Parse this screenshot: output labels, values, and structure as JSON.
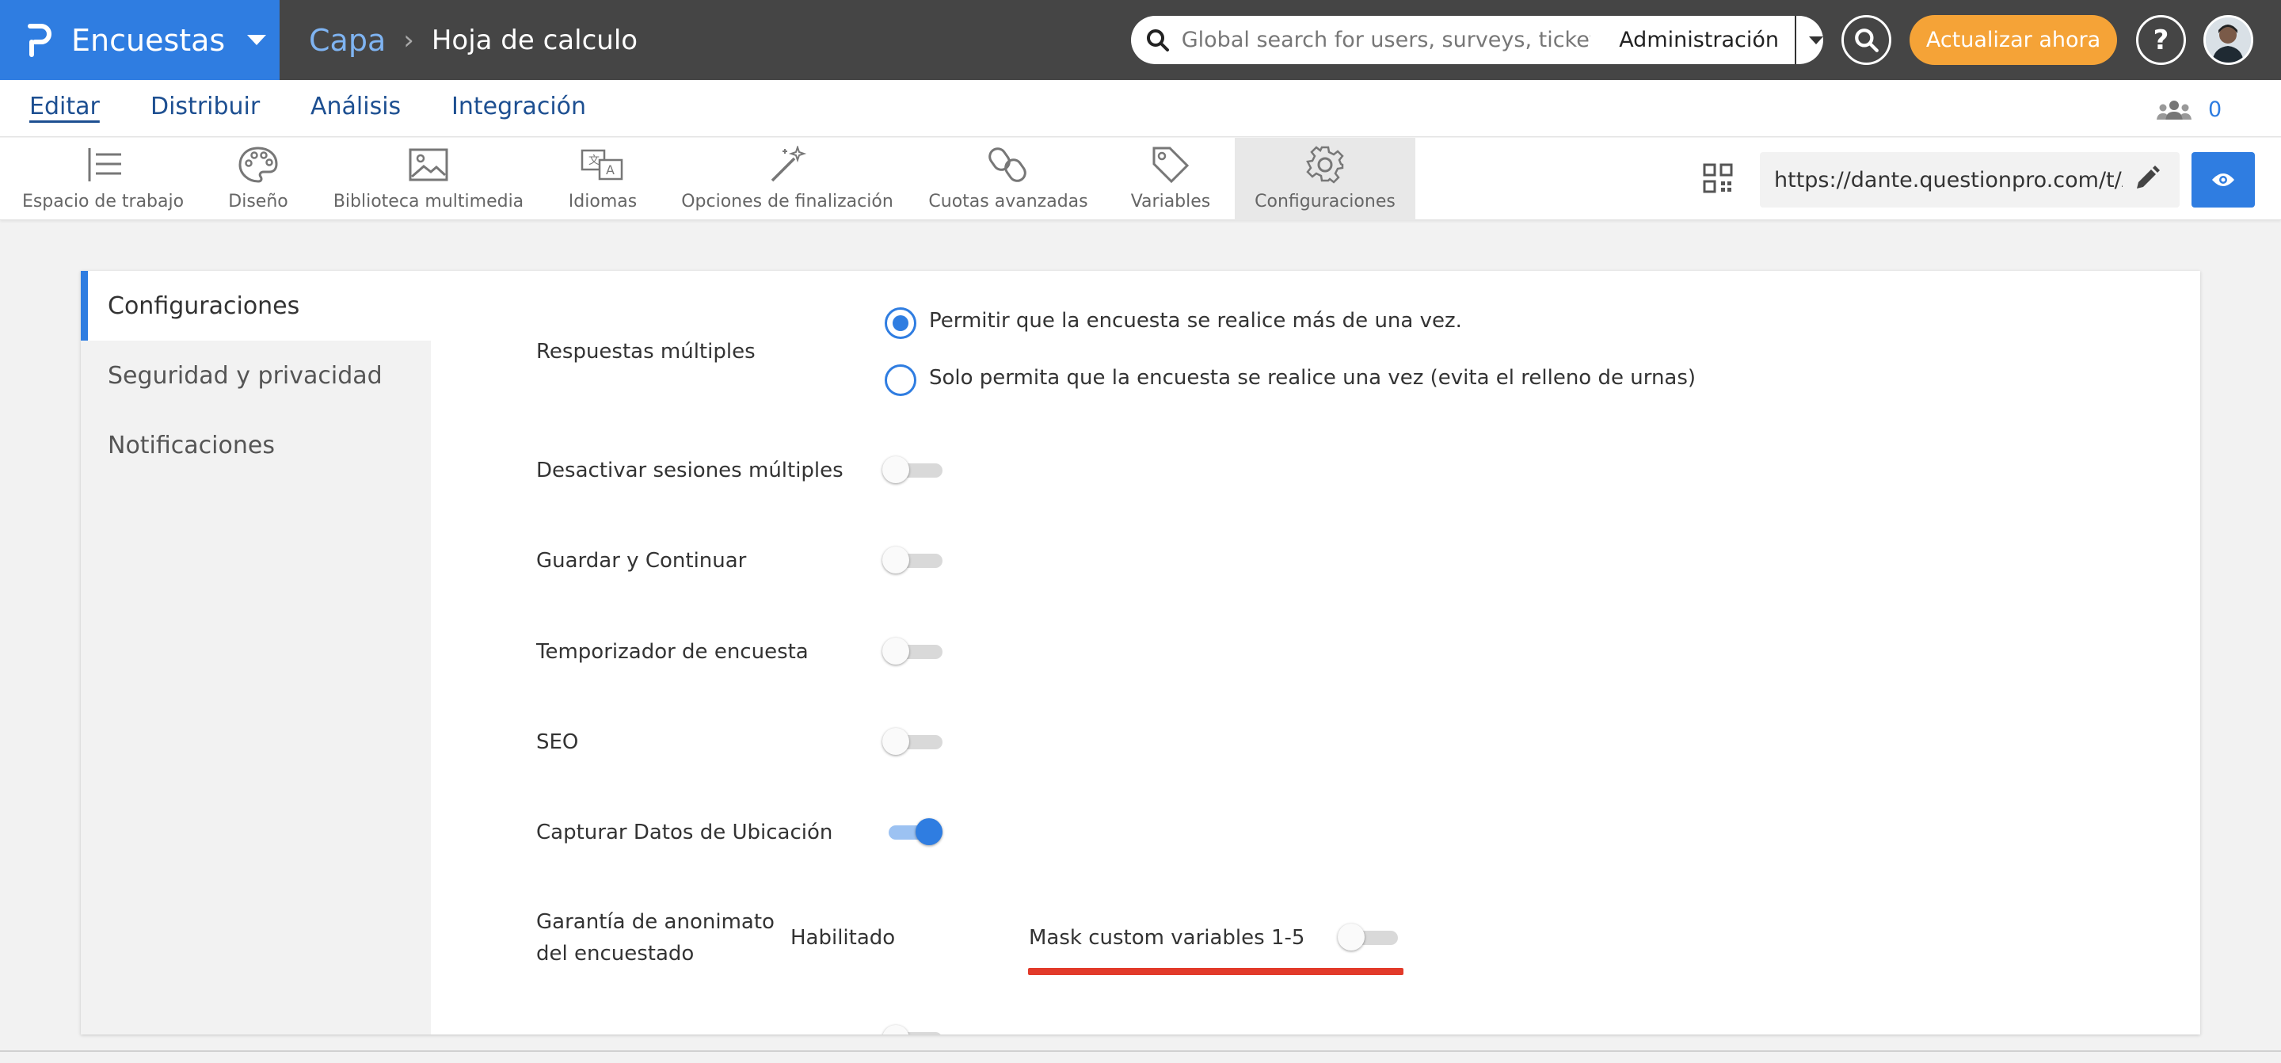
{
  "topbar": {
    "brand": "Encuestas",
    "breadcrumb": [
      "Capa",
      "Hoja de calculo"
    ],
    "search_placeholder": "Global search for users, surveys, tickets",
    "search_scope": "Administración",
    "upgrade_label": "Actualizar ahora",
    "help_label": "?"
  },
  "nav": {
    "tabs": [
      "Editar",
      "Distribuir",
      "Análisis",
      "Integración"
    ],
    "active_tab": "Editar",
    "collaborators_count": "0"
  },
  "toolbar": {
    "tools": [
      {
        "label": "Espacio de trabajo",
        "icon": "workspace-icon"
      },
      {
        "label": "Diseño",
        "icon": "palette-icon"
      },
      {
        "label": "Biblioteca multimedia",
        "icon": "image-icon"
      },
      {
        "label": "Idiomas",
        "icon": "translate-icon"
      },
      {
        "label": "Opciones de finalización",
        "icon": "magic-wand-icon"
      },
      {
        "label": "Cuotas avanzadas",
        "icon": "link-icon"
      },
      {
        "label": "Variables",
        "icon": "tag-icon"
      },
      {
        "label": "Configuraciones",
        "icon": "gear-icon"
      }
    ],
    "active_tool": "Configuraciones",
    "survey_url": "https://dante.questionpro.com/t/AS"
  },
  "sidebar": {
    "items": [
      "Configuraciones",
      "Seguridad y privacidad",
      "Notificaciones"
    ],
    "active": "Configuraciones"
  },
  "settings": {
    "multiple_responses": {
      "label": "Respuestas múltiples",
      "options": [
        "Permitir que la encuesta se realice más de una vez.",
        "Solo permita que la encuesta se realice una vez (evita el relleno de urnas)"
      ],
      "selected_index": 0
    },
    "toggles": [
      {
        "label": "Desactivar sesiones múltiples",
        "on": false
      },
      {
        "label": "Guardar y Continuar",
        "on": false
      },
      {
        "label": "Temporizador de encuesta",
        "on": false
      },
      {
        "label": "SEO",
        "on": false
      },
      {
        "label": "Capturar Datos de Ubicación",
        "on": true
      }
    ],
    "anonymity": {
      "label_line1": "Garantía de anonimato",
      "label_line2": "del encuestado",
      "status": "Habilitado",
      "mask_label": "Mask custom variables 1-5",
      "mask_on": false
    }
  },
  "colors": {
    "brand_blue": "#2f7de1",
    "topbar_dark": "#454545",
    "upgrade_orange": "#f5a337",
    "annotation_red": "#e23a2a"
  }
}
